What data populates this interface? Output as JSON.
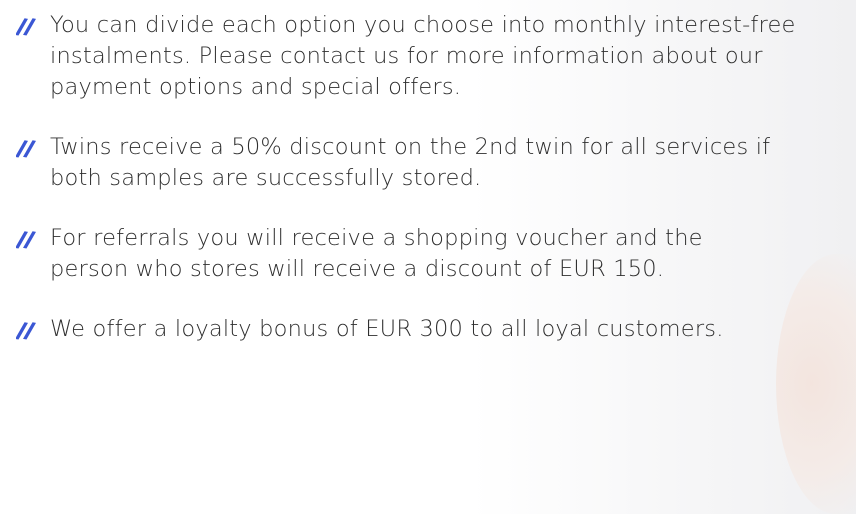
{
  "benefits": [
    {
      "icon": "double-slash-bullet-icon",
      "text": "You can divide each option you choose into monthly interest-free instalments. Please contact us for more information about our payment options and special offers."
    },
    {
      "icon": "double-slash-bullet-icon",
      "text": "Twins receive a 50% discount on the 2nd twin for all services if both samples are successfully stored."
    },
    {
      "icon": "double-slash-bullet-icon",
      "text": "For referrals you will receive a shopping voucher and the person who stores will receive a discount of EUR 150."
    },
    {
      "icon": "double-slash-bullet-icon",
      "text": "We offer a loyalty bonus of EUR 300 to all loyal customers."
    }
  ],
  "colors": {
    "accent": "#3b57d4",
    "text": "#2f2f2f"
  }
}
